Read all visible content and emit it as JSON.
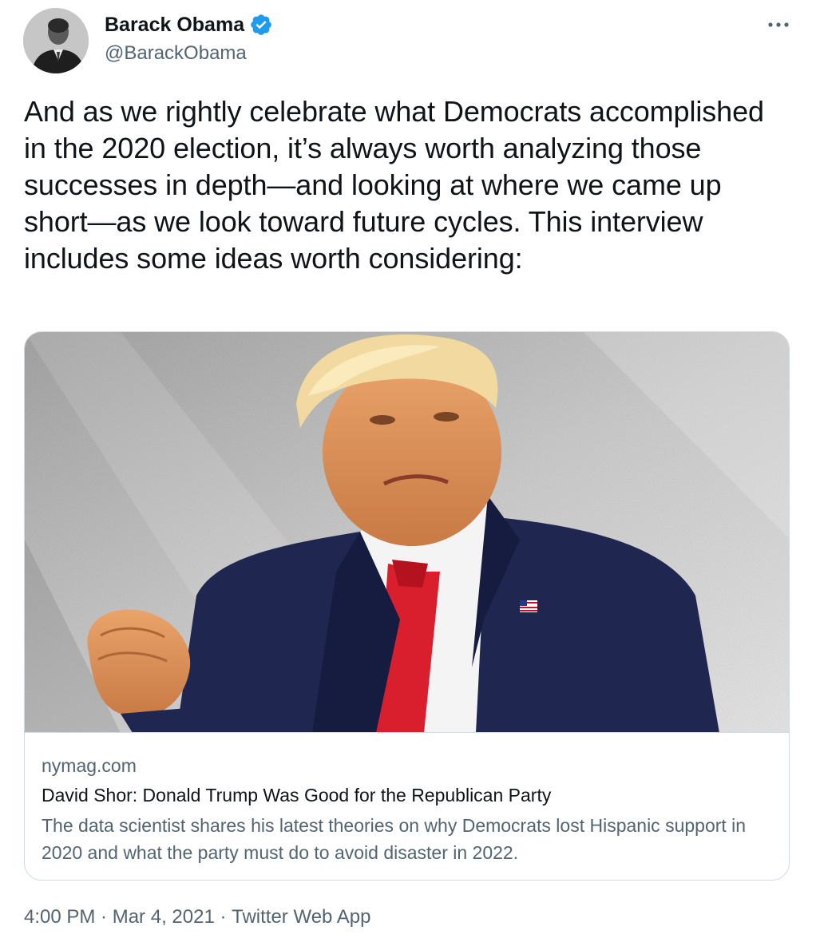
{
  "author": {
    "display_name": "Barack Obama",
    "handle": "@BarackObama",
    "verified": true,
    "avatar_icon": "avatar-portrait"
  },
  "more_icon": "ellipsis-icon",
  "tweet": {
    "text": "And as we rightly celebrate what Democrats accomplished in the 2020 election, it’s always worth analyzing those successes in depth—and looking at where we came up short—as we look toward future cycles. This interview includes some ideas worth considering:"
  },
  "card": {
    "domain": "nymag.com",
    "title": "David Shor: Donald Trump Was Good for the Republican Party",
    "description": "The data scientist shares his latest theories on why Democrats lost Hispanic support in 2020 and what the party must do to avoid disaster in 2022."
  },
  "meta": {
    "time": "4:00 PM",
    "separator": " · ",
    "date": "Mar 4, 2021",
    "source": "Twitter Web App"
  },
  "colors": {
    "text_primary": "#0f1419",
    "text_secondary": "#536471",
    "verified_blue": "#1d9bf0",
    "border": "#cfd9de"
  }
}
